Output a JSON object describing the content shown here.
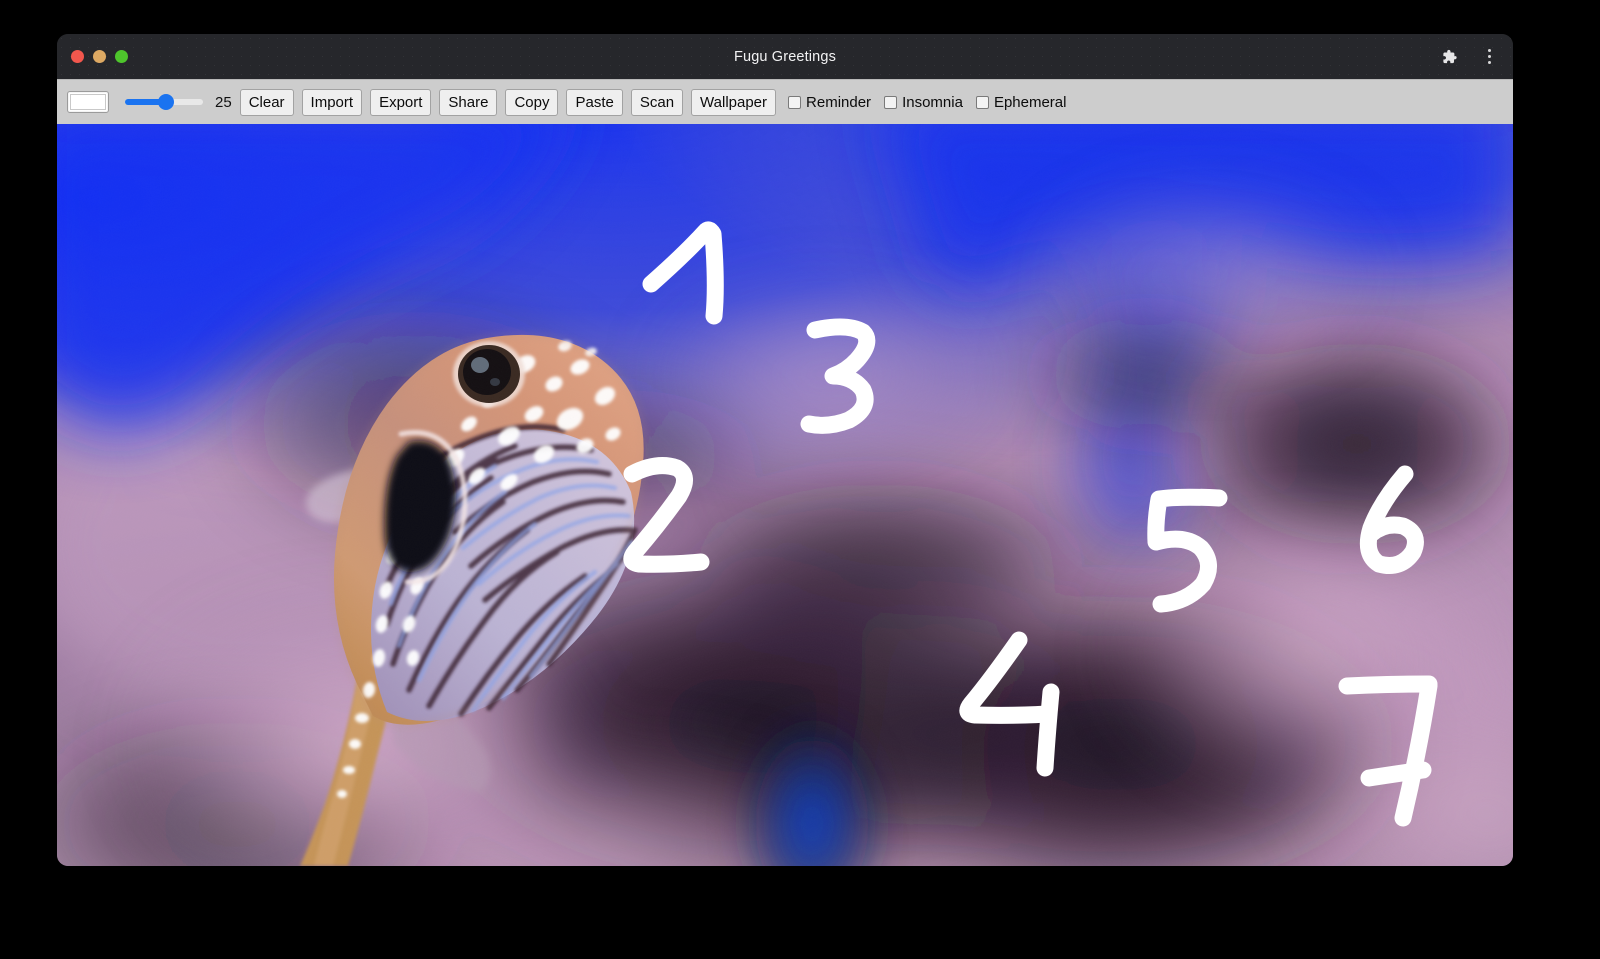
{
  "window": {
    "title": "Fugu Greetings",
    "traffic_lights": [
      {
        "name": "close",
        "color": "#f2574d"
      },
      {
        "name": "minimize",
        "color": "#dda963"
      },
      {
        "name": "maximize",
        "color": "#4ec52c"
      }
    ],
    "right_icons": [
      {
        "name": "extensions-icon",
        "glyph": "puzzle"
      },
      {
        "name": "more-menu-icon",
        "glyph": "kebab"
      }
    ]
  },
  "toolbar": {
    "color_picker": {
      "label": "color",
      "value": "#ffffff"
    },
    "slider": {
      "label": "line width",
      "value": 25,
      "min": 0,
      "max": 50,
      "percent": 50,
      "accent": "#1a73f0"
    },
    "slider_value_text": "25",
    "buttons": [
      {
        "label": "Clear",
        "name": "clear-button"
      },
      {
        "label": "Import",
        "name": "import-button"
      },
      {
        "label": "Export",
        "name": "export-button"
      },
      {
        "label": "Share",
        "name": "share-button"
      },
      {
        "label": "Copy",
        "name": "copy-button"
      },
      {
        "label": "Paste",
        "name": "paste-button"
      },
      {
        "label": "Scan",
        "name": "scan-button"
      },
      {
        "label": "Wallpaper",
        "name": "wallpaper-button"
      }
    ],
    "checkboxes": [
      {
        "label": "Reminder",
        "name": "reminder-checkbox",
        "checked": false
      },
      {
        "label": "Insomnia",
        "name": "insomnia-checkbox",
        "checked": false
      },
      {
        "label": "Ephemeral",
        "name": "ephemeral-checkbox",
        "checked": false
      }
    ]
  },
  "canvas": {
    "description": "Photograph of a pufferfish (fugu) swimming over blurred purple coral with blue water at the top",
    "ink_color": "#ffffff",
    "strokes": [
      "1",
      "2",
      "3",
      "4",
      "5",
      "6",
      "7"
    ]
  },
  "colors": {
    "titlebar_bg": "#26272b",
    "toolbar_bg": "#cdcdcd",
    "accent": "#1a73f0",
    "desktop_bg": "#000000",
    "water_blue": "#1433ef",
    "coral_purple": "#b089b9"
  }
}
